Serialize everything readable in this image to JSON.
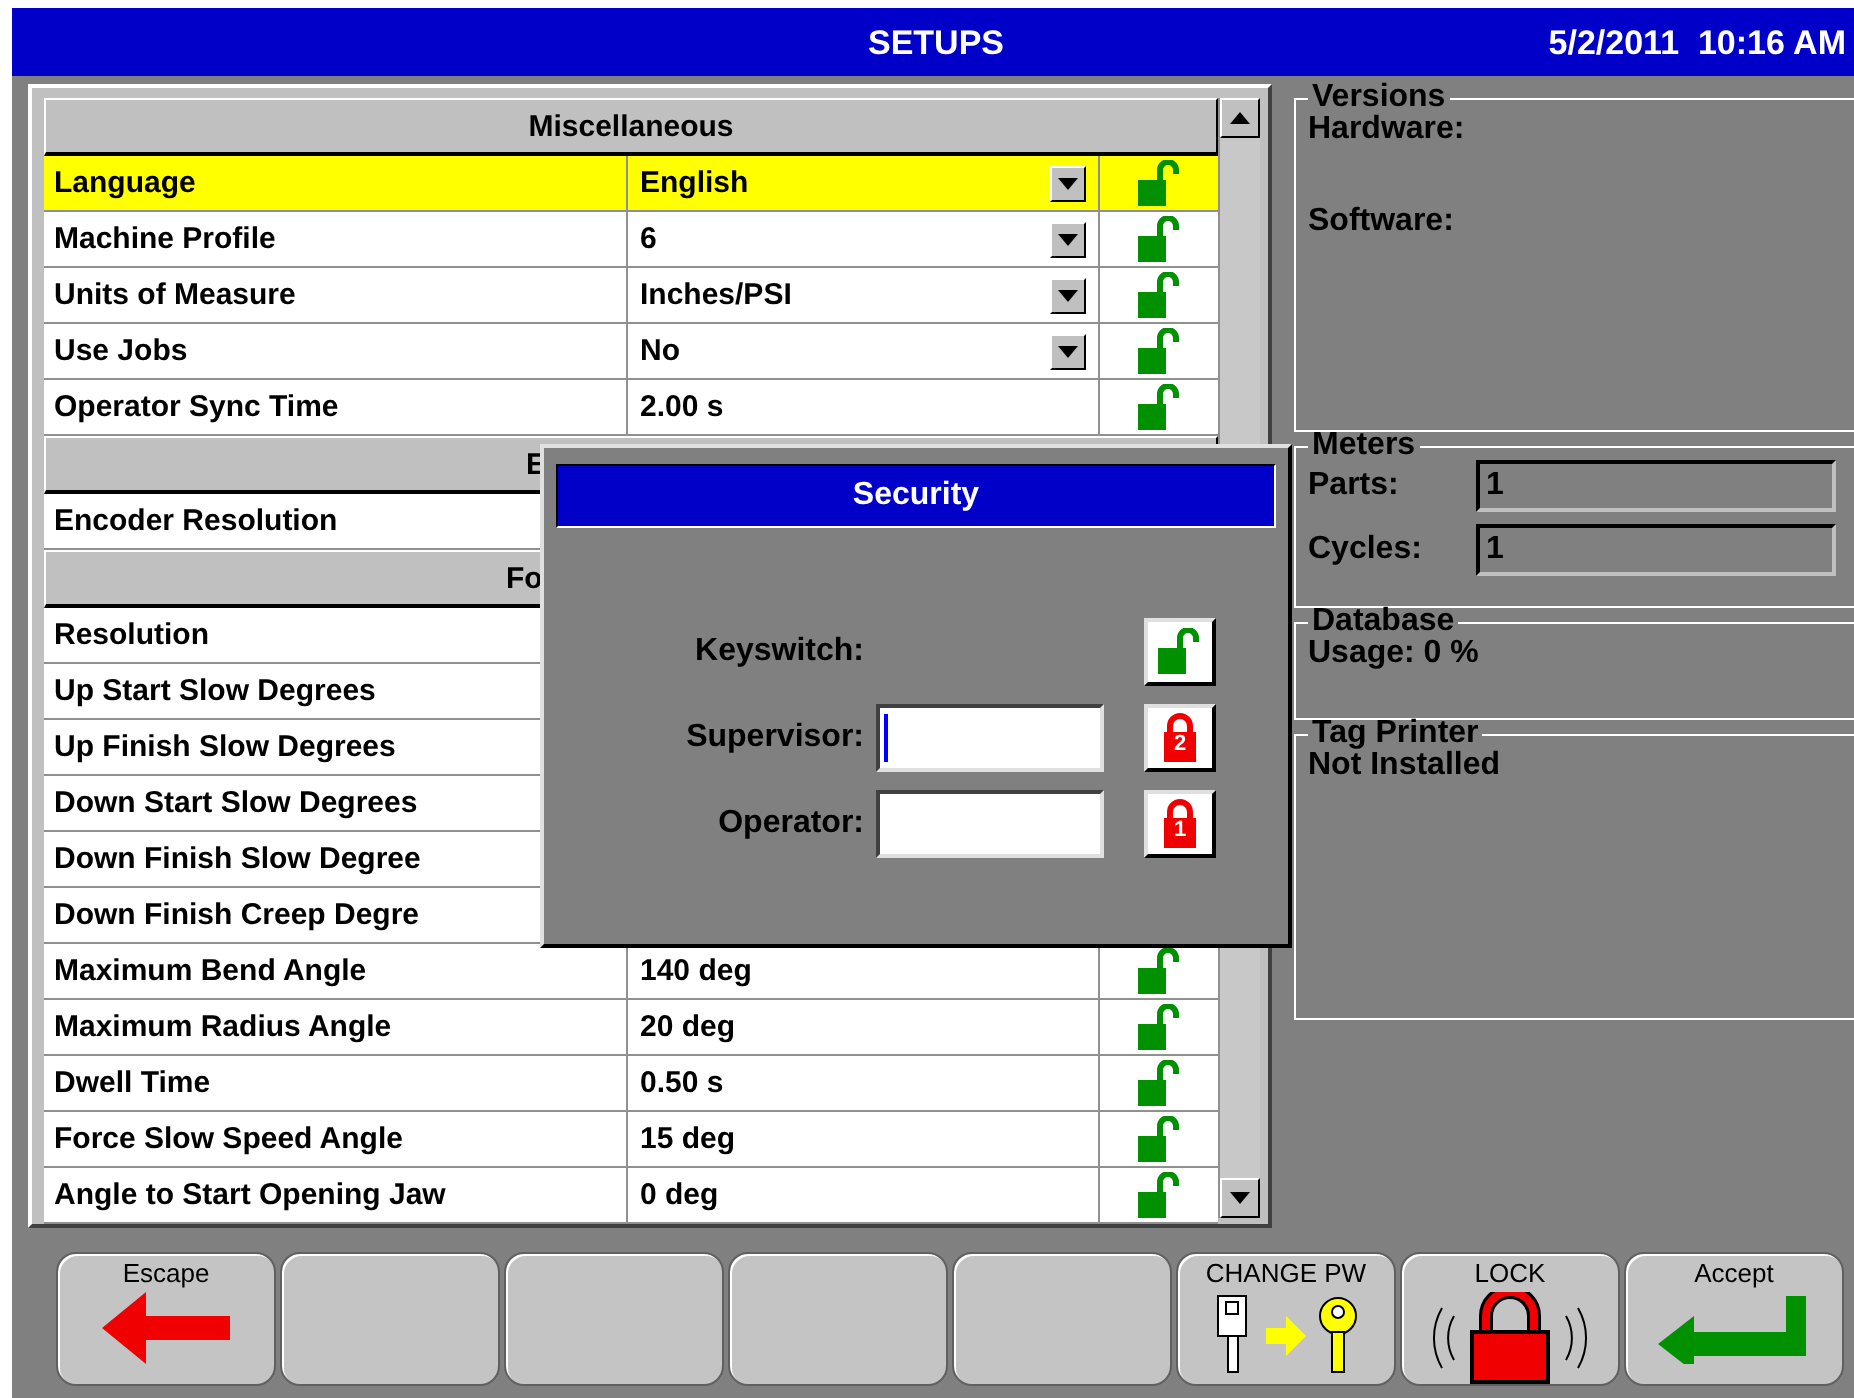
{
  "title_bar": {
    "title": "SETUPS",
    "datetime": "5/2/2011  10:16 AM"
  },
  "settings": {
    "sections": [
      {
        "title": "Miscellaneous",
        "kind": "full",
        "rows": [
          {
            "label": "Language",
            "value": "English",
            "dropdown": true,
            "locked": false,
            "selected": true
          },
          {
            "label": "Machine Profile",
            "value": "6",
            "dropdown": true,
            "locked": false,
            "selected": false
          },
          {
            "label": "Units of Measure",
            "value": "Inches/PSI",
            "dropdown": true,
            "locked": false,
            "selected": false
          },
          {
            "label": "Use Jobs",
            "value": "No",
            "dropdown": true,
            "locked": false,
            "selected": false
          },
          {
            "label": "Operator Sync Time",
            "value": "2.00 s",
            "dropdown": false,
            "locked": false,
            "selected": false
          }
        ]
      },
      {
        "title": "E",
        "kind": "cut",
        "rows": [
          {
            "label": "Encoder Resolution",
            "selected": false
          }
        ]
      },
      {
        "title": "Fo",
        "kind": "cut",
        "rows": [
          {
            "label": "Resolution",
            "selected": false
          },
          {
            "label": "Up Start Slow Degrees",
            "selected": false
          },
          {
            "label": "Up Finish Slow Degrees",
            "selected": false
          },
          {
            "label": "Down Start Slow Degrees",
            "selected": false
          },
          {
            "label": "Down Finish Slow Degree",
            "selected": false
          },
          {
            "label": "Down Finish Creep Degre",
            "selected": false
          },
          {
            "label": "Maximum Bend Angle",
            "value": "140 deg",
            "dropdown": false,
            "locked": false,
            "selected": false
          },
          {
            "label": "Maximum Radius Angle",
            "value": "20 deg",
            "dropdown": false,
            "locked": false,
            "selected": false
          },
          {
            "label": "Dwell Time",
            "value": "0.50 s",
            "dropdown": false,
            "locked": false,
            "selected": false
          },
          {
            "label": "Force Slow Speed Angle",
            "value": "15 deg",
            "dropdown": false,
            "locked": false,
            "selected": false
          },
          {
            "label": "Angle to Start Opening Jaw",
            "value": "0 deg",
            "dropdown": false,
            "locked": false,
            "selected": false
          }
        ]
      }
    ]
  },
  "info_panel": {
    "versions": {
      "title": "Versions",
      "items": [
        "Hardware:",
        "Software:"
      ]
    },
    "meters": {
      "title": "Meters",
      "items": [
        {
          "label": "Parts:",
          "value": "1"
        },
        {
          "label": "Cycles:",
          "value": "1"
        }
      ]
    },
    "database": {
      "title": "Database",
      "usage": "Usage: 0 %"
    },
    "tag_printer": {
      "title": "Tag Printer",
      "status": "Not Installed"
    }
  },
  "security_dialog": {
    "title": "Security",
    "fields": [
      {
        "label": "Keyswitch:",
        "kind": "keyswitch",
        "locked": false
      },
      {
        "label": "Supervisor:",
        "kind": "password",
        "lock_number": "2",
        "focused": true
      },
      {
        "label": "Operator:",
        "kind": "password",
        "lock_number": "1",
        "focused": false
      }
    ]
  },
  "function_keys": [
    {
      "label": "Escape",
      "kind": "back"
    },
    {
      "kind": "blank"
    },
    {
      "kind": "blank"
    },
    {
      "kind": "blank"
    },
    {
      "kind": "blank"
    },
    {
      "label": "CHANGE PW",
      "kind": "change-password"
    },
    {
      "label": "LOCK",
      "kind": "lock"
    },
    {
      "label": "Accept",
      "kind": "accept"
    }
  ]
}
